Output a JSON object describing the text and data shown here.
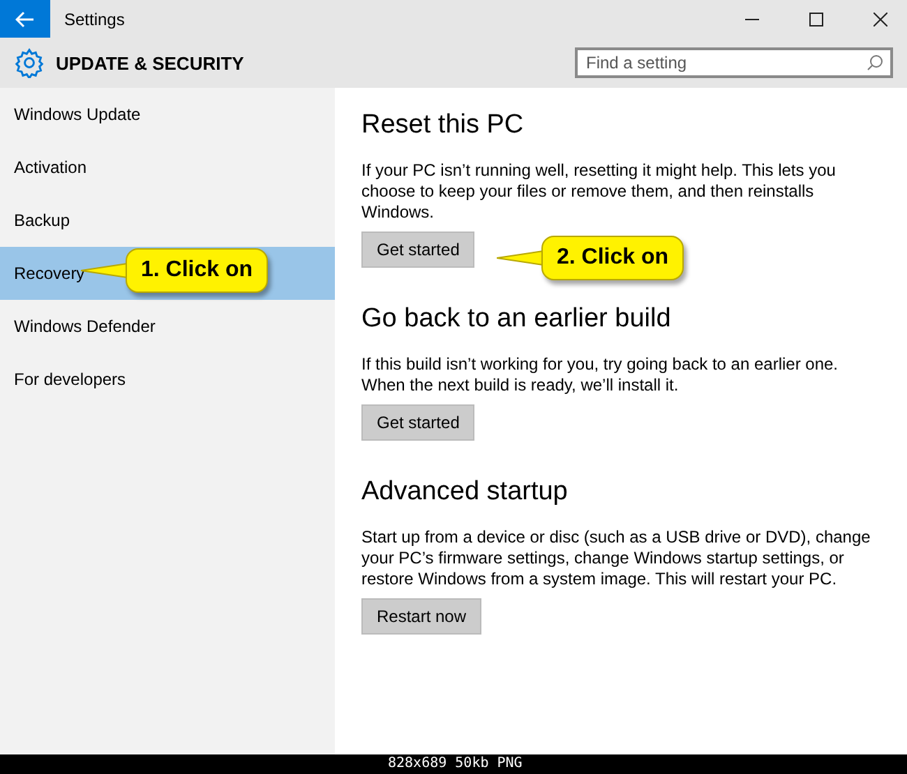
{
  "window": {
    "title": "Settings"
  },
  "header": {
    "title": "UPDATE & SECURITY",
    "search": {
      "placeholder": "Find a setting"
    }
  },
  "sidebar": {
    "items": [
      {
        "label": "Windows Update",
        "selected": false
      },
      {
        "label": "Activation",
        "selected": false
      },
      {
        "label": "Backup",
        "selected": false
      },
      {
        "label": "Recovery",
        "selected": true
      },
      {
        "label": "Windows Defender",
        "selected": false
      },
      {
        "label": "For developers",
        "selected": false
      }
    ]
  },
  "sections": [
    {
      "title": "Reset this PC",
      "text": "If your PC isn’t running well, resetting it might help. This lets you choose to keep your files or remove them, and then reinstalls Windows.",
      "button": "Get started"
    },
    {
      "title": "Go back to an earlier build",
      "text": "If this build isn’t working for you, try going back to an earlier one. When the next build is ready, we’ll install it.",
      "button": "Get started"
    },
    {
      "title": "Advanced startup",
      "text": "Start up from a device or disc (such as a USB drive or DVD), change your PC’s firmware settings, change Windows startup settings, or restore Windows from a system image. This will restart your PC.",
      "button": "Restart now"
    }
  ],
  "callouts": [
    {
      "text": "1. Click on",
      "kind": "sidebar"
    },
    {
      "text": "2. Click on",
      "kind": "section"
    }
  ],
  "image_info_bar": "828x689 50kb PNG"
}
